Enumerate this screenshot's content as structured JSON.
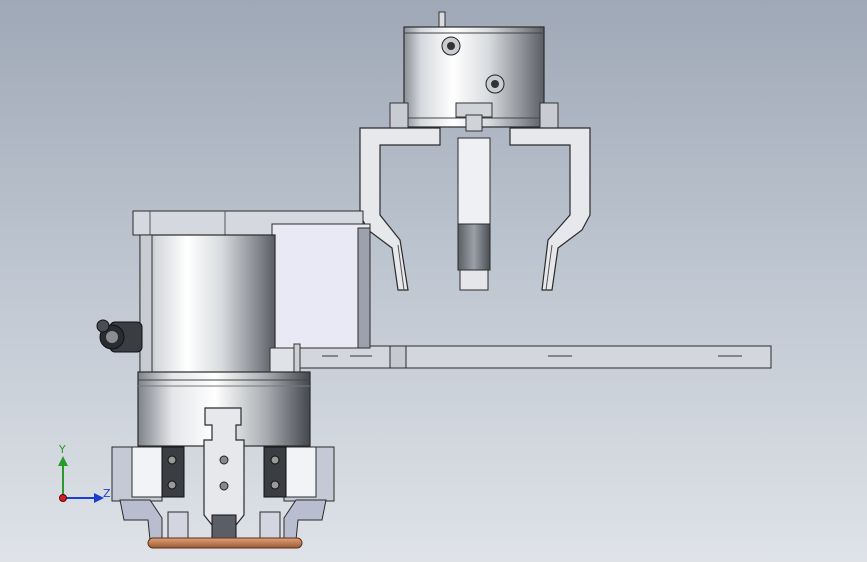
{
  "view": {
    "background_top": "#9fa8b6",
    "background_bottom": "#dfe3e8"
  },
  "triad": {
    "y_label": "Y",
    "z_label": "Z",
    "y_color": "#2a9a2a",
    "z_color": "#1a3fd0",
    "x_color": "#d02020"
  }
}
